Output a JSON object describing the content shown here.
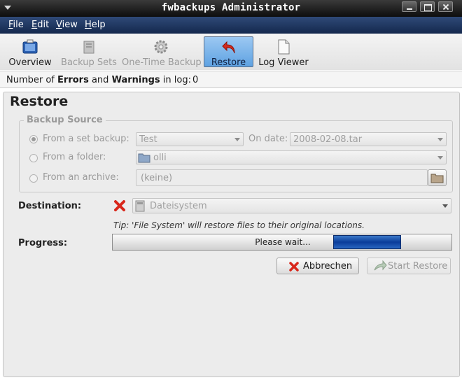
{
  "window": {
    "title": "fwbackups Administrator"
  },
  "menu": [
    "File",
    "Edit",
    "View",
    "Help"
  ],
  "toolbar": {
    "overview": "Overview",
    "backup_sets": "Backup Sets",
    "one_time_backup": "One-Time Backup",
    "restore": "Restore",
    "log_viewer": "Log Viewer"
  },
  "status": {
    "prefix": "Number of ",
    "errors": "Errors",
    "and": " and ",
    "warnings": "Warnings",
    "suffix": " in log:",
    "count": "0"
  },
  "restore": {
    "heading": "Restore",
    "source_legend": "Backup Source",
    "from_set_label": "From a set backup:",
    "set_value": "Test",
    "on_date_label": "On date:",
    "date_value": "2008-02-08.tar",
    "from_folder_label": "From a folder:",
    "folder_value": "olli",
    "from_archive_label": "From an archive:",
    "archive_value": "(keine)",
    "destination_label": "Destination:",
    "destination_value": "Dateisystem",
    "tip": "Tip: 'File System' will restore files to their original locations.",
    "progress_label": "Progress:",
    "progress_text": "Please wait...",
    "cancel_label": "Abbrechen",
    "start_label": "Start Restore"
  },
  "colors": {
    "menubar": "#1e3761",
    "active_tool": "#6eaee8",
    "progress_pulse": "#0a3c9a"
  }
}
